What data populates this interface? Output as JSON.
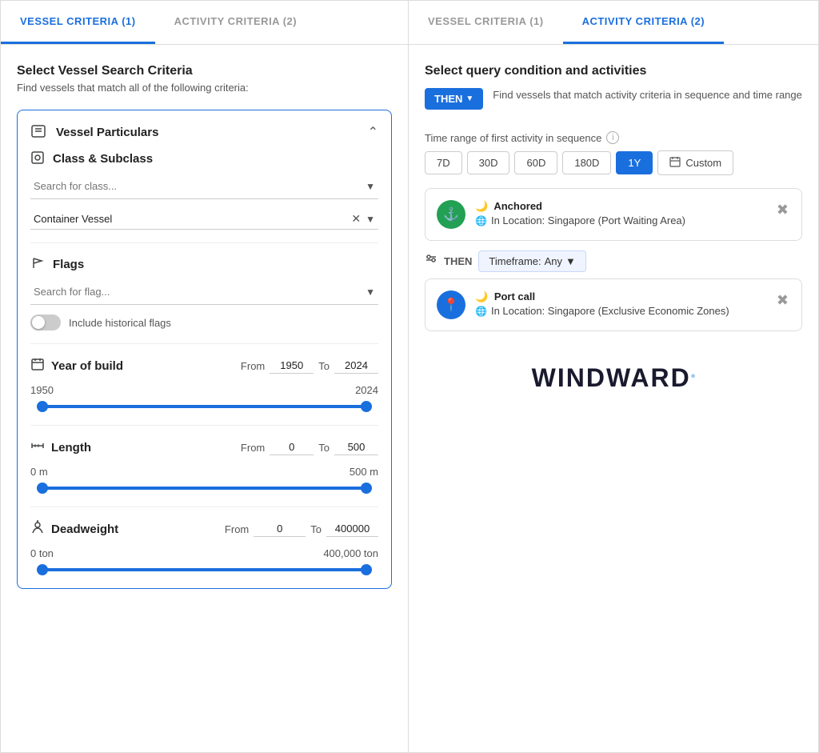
{
  "left": {
    "tabs": [
      {
        "label": "VESSEL CRITERIA (1)",
        "active": true
      },
      {
        "label": "ACTIVITY CRITERIA (2)",
        "active": false
      }
    ],
    "title": "Select Vessel Search Criteria",
    "subtitle": "Find vessels that match all of the following criteria:",
    "sections": {
      "vessel_particulars": {
        "title": "Vessel Particulars",
        "collapsed": false
      },
      "class_subclass": {
        "title": "Class & Subclass",
        "search_placeholder": "Search for class...",
        "selected_value": "Container Vessel"
      },
      "flags": {
        "title": "Flags",
        "search_placeholder": "Search for flag...",
        "historical_label": "Include historical flags"
      },
      "year_of_build": {
        "title": "Year of build",
        "from_label": "From",
        "to_label": "To",
        "from_value": "1950",
        "to_value": "2024",
        "min_label": "1950",
        "max_label": "2024"
      },
      "length": {
        "title": "Length",
        "from_label": "From",
        "to_label": "To",
        "from_value": "0",
        "to_value": "500",
        "min_label": "0 m",
        "max_label": "500 m"
      },
      "deadweight": {
        "title": "Deadweight",
        "from_label": "From",
        "to_label": "To",
        "from_value": "0",
        "to_value": "400000",
        "min_label": "0 ton",
        "max_label": "400,000 ton"
      }
    }
  },
  "right": {
    "tabs": [
      {
        "label": "VESSEL CRITERIA (1)",
        "active": false
      },
      {
        "label": "ACTIVITY CRITERIA (2)",
        "active": true
      }
    ],
    "title": "Select query condition and activities",
    "then_label": "THEN",
    "sequence_label": "Find vessels that match activity criteria in sequence and time range",
    "time_range_label": "Time range of first activity in sequence",
    "time_buttons": [
      "7D",
      "30D",
      "60D",
      "180D",
      "1Y"
    ],
    "active_time": "1Y",
    "custom_label": "Custom",
    "activities": [
      {
        "id": 1,
        "icon_type": "green",
        "icon": "anchor",
        "name": "Anchored",
        "location_icon": "globe",
        "location": "In Location: Singapore (Port Waiting Area)"
      },
      {
        "id": 2,
        "icon_type": "blue",
        "icon": "pin",
        "name": "Port call",
        "location_icon": "globe",
        "location": "In Location: Singapore (Exclusive Economic Zones)"
      }
    ],
    "connector": {
      "icon": "filter",
      "then_label": "THEN",
      "timeframe_label": "Timeframe:",
      "timeframe_value": "Any",
      "timeframe_arrow": "▼"
    },
    "logo": {
      "text": "WINDWARD",
      "dot": "°"
    }
  }
}
